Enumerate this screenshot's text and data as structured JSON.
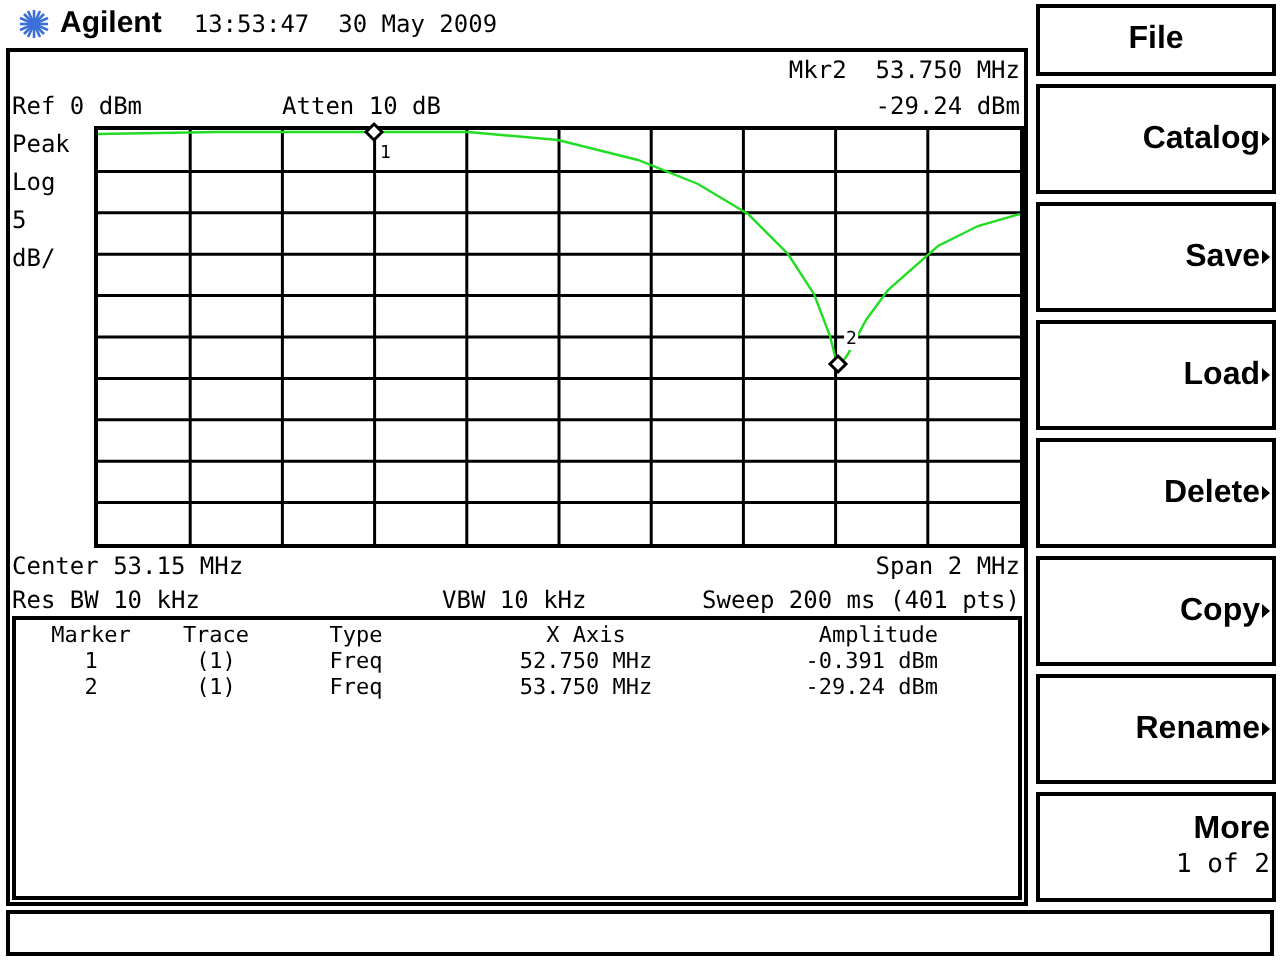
{
  "header": {
    "brand": "Agilent",
    "datetime": "13:53:47  30 May 2009"
  },
  "readout": {
    "marker": "Mkr2  53.750 MHz",
    "ref": "Ref 0 dBm",
    "atten": "Atten 10 dB",
    "amplitude": "-29.24 dBm"
  },
  "scale_labels": [
    "Peak",
    "Log",
    "5",
    "dB/"
  ],
  "trace_markers": [
    {
      "label": "1"
    },
    {
      "label": "2"
    }
  ],
  "settings": {
    "center": "Center 53.15 MHz",
    "span": "Span 2 MHz",
    "res_bw": "Res BW 10 kHz",
    "vbw": "VBW 10 kHz",
    "sweep": "Sweep 200 ms (401 pts)"
  },
  "marker_table": {
    "columns": [
      "Marker",
      "Trace",
      "Type",
      "X Axis",
      "Amplitude"
    ],
    "rows": [
      [
        "1",
        "(1)",
        "Freq",
        "52.750 MHz",
        "-0.391 dBm"
      ],
      [
        "2",
        "(1)",
        "Freq",
        "53.750 MHz",
        "-29.24 dBm"
      ]
    ]
  },
  "softkeys": [
    {
      "label": "File",
      "kind": "title"
    },
    {
      "label": "Catalog",
      "kind": "submenu"
    },
    {
      "label": "Save",
      "kind": "submenu"
    },
    {
      "label": "Load",
      "kind": "submenu"
    },
    {
      "label": "Delete",
      "kind": "submenu"
    },
    {
      "label": "Copy",
      "kind": "submenu"
    },
    {
      "label": "Rename",
      "kind": "submenu"
    },
    {
      "label": "More",
      "sublabel": "1 of 2",
      "kind": "more"
    }
  ]
}
